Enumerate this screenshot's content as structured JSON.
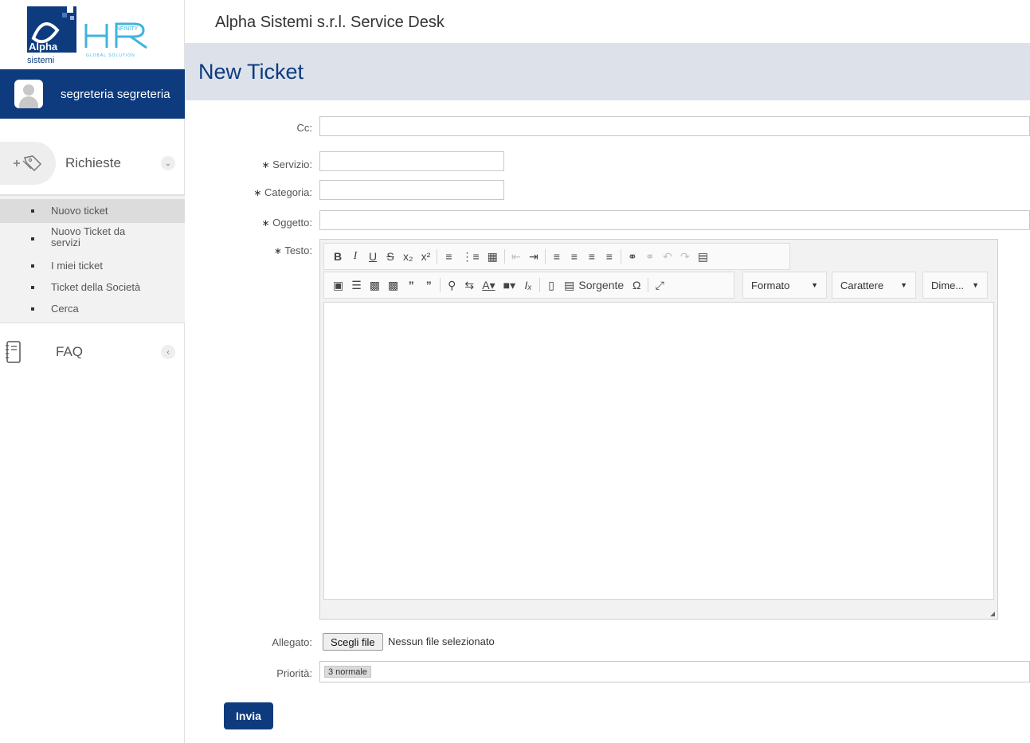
{
  "brand": {
    "logo_alpha": "Alpha",
    "logo_sistemi": "sistemi",
    "logo_hr": "HR",
    "logo_infinity": "INFINITY",
    "logo_tagline": "GLOBAL SOLUTION",
    "accent": "#0d3b7e"
  },
  "header": {
    "site_title": "Alpha Sistemi s.r.l. Service Desk",
    "page_title": "New Ticket"
  },
  "user": {
    "name": "segreteria segreteria"
  },
  "sidebar": {
    "richieste_label": "Richieste",
    "items": [
      {
        "label": "Nuovo ticket",
        "active": true
      },
      {
        "label": "Nuovo Ticket da servizi"
      },
      {
        "label": "I miei ticket"
      },
      {
        "label": "Ticket della Società"
      },
      {
        "label": "Cerca"
      }
    ],
    "faq_label": "FAQ"
  },
  "form": {
    "cc_label": "Cc:",
    "servizio_label": "Servizio:",
    "categoria_label": "Categoria:",
    "oggetto_label": "Oggetto:",
    "testo_label": "Testo:",
    "allegato_label": "Allegato:",
    "priorita_label": "Priorità:",
    "required_mark": "∗",
    "cc_value": "",
    "servizio_value": "",
    "categoria_value": "",
    "oggetto_value": "",
    "file_button": "Scegli file",
    "file_status": "Nessun file selezionato",
    "priorita_value": "3 normale",
    "submit_label": "Invia"
  },
  "editor": {
    "source_label": "Sorgente",
    "format_label": "Formato",
    "font_label": "Carattere",
    "size_label": "Dime..."
  }
}
